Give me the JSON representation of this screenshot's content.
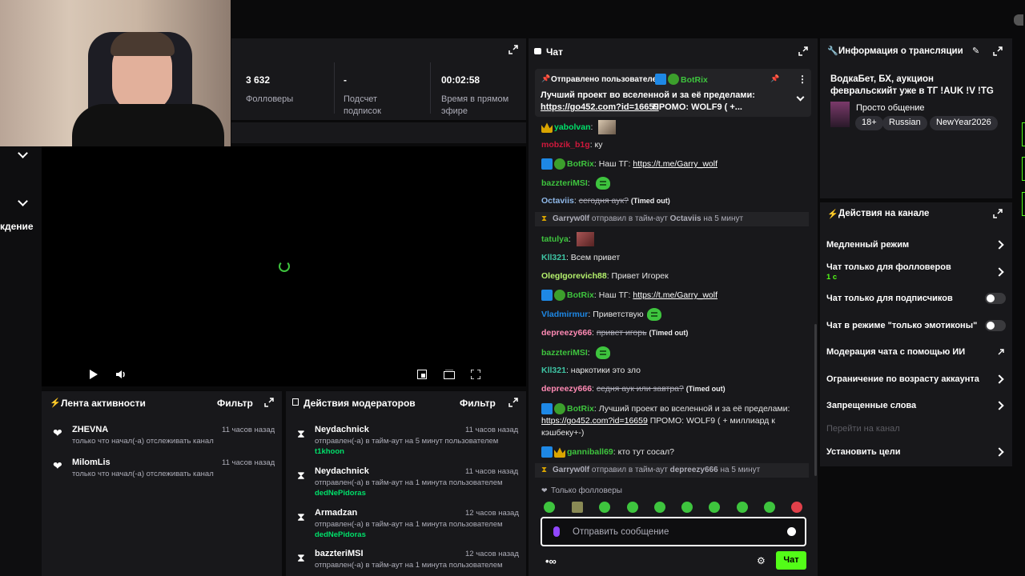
{
  "stats": {
    "followers_value": "3 632",
    "followers_label": "Фолловеры",
    "subs_value": "-",
    "subs_label": "Подсчет подписок",
    "uptime_value": "00:02:58",
    "uptime_label": "Время в прямом эфире"
  },
  "left_partial_label": "кдение",
  "activity": {
    "title": "Лента активности",
    "filter": "Фильтр",
    "items": [
      {
        "name": "ZHEVNA",
        "text": "только что начал(-а) отслеживать канал",
        "time": "11 часов назад"
      },
      {
        "name": "MilomLis",
        "text": "только что начал(-а) отслеживать канал",
        "time": "11 часов назад"
      }
    ]
  },
  "mod": {
    "title": "Действия модераторов",
    "filter": "Фильтр",
    "items": [
      {
        "name": "Neydachnick",
        "text": "отправлен(-а) в тайм-аут на 5 минут пользователем",
        "target": "t1khoon",
        "time": "11 часов назад"
      },
      {
        "name": "Neydachnick",
        "text": "отправлен(-а) в тайм-аут на 1 минута пользователем",
        "target": "dedNePidoras",
        "time": "11 часов назад"
      },
      {
        "name": "Armadzan",
        "text": "отправлен(-а) в тайм-аут на 1 минута пользователем",
        "target": "dedNePidoras",
        "time": "12 часов назад"
      },
      {
        "name": "bazzteriMSI",
        "text": "отправлен(-а) в тайм-аут на 1 минута пользователем",
        "target": "",
        "time": "12 часов назад"
      }
    ]
  },
  "chat": {
    "title": "Чат",
    "pinned_by": "Отправлено пользователем",
    "pinned_user": "BotRix",
    "pinned_text": "Лучший проект во вселенной и за её пределами:",
    "pinned_link": "https://go452.com?id=16659",
    "pinned_tail": "ПРОМО: WOLF9 ( +...",
    "messages": [
      {
        "user": "yabolvan",
        "color": "#00e06a",
        "text": ""
      },
      {
        "user": "mobzik_b1g",
        "color": "#d0183c",
        "text": "ку"
      },
      {
        "user": "BotRix",
        "color": "#3ec43e",
        "text": "Наш ТГ:",
        "link": "https://t.me/Garry_wolf"
      },
      {
        "user": "bazzteriMSI",
        "color": "#3ec43e",
        "text": ""
      },
      {
        "user": "Octaviis",
        "color": "#8fb8e8",
        "text": "сегодня аук?",
        "timeout": "(Timed out)"
      },
      {
        "user": "tatulya",
        "color": "#3ec43e",
        "text": ""
      },
      {
        "user": "Kll321",
        "color": "#3ec4a4",
        "text": "Всем привет"
      },
      {
        "user": "OlegIgorevich88",
        "color": "#b4f06c",
        "text": "Привет Игорек"
      },
      {
        "user": "BotRix",
        "color": "#3ec43e",
        "text": "Наш ТГ:",
        "link": "https://t.me/Garry_wolf"
      },
      {
        "user": "Vladmirmur",
        "color": "#1e88e5",
        "text": "Приветствую"
      },
      {
        "user": "depreezy666",
        "color": "#ff8ab4",
        "text": "привет игорь",
        "timeout": "(Timed out)"
      },
      {
        "user": "bazzteriMSI",
        "color": "#3ec43e",
        "text": ""
      },
      {
        "user": "Kll321",
        "color": "#3ec4a4",
        "text": "наркотики это зло"
      },
      {
        "user": "depreezy666",
        "color": "#ff8ab4",
        "text": "седня аук или завтра?",
        "timeout": "(Timed out)"
      },
      {
        "user": "BotRix",
        "color": "#3ec43e",
        "text": "Лучший проект во вселенной и за её пределами:",
        "link": "https://go452.com?id=16659",
        "tail": "ПРОМО: WOLF9 ( + миллиард к кэшбеку+-)"
      },
      {
        "user": "ganniball69",
        "color": "#3ec43e",
        "text": "кто тут сосал?"
      }
    ],
    "sys1": {
      "mod": "Garryw0lf",
      "mid": "отправил в тайм-аут",
      "target": "Octaviis",
      "dur": "на 5 минут"
    },
    "sys2": {
      "mod": "Garryw0lf",
      "mid": "отправил в тайм-аут",
      "target": "depreezy666",
      "dur": "на 5 минут"
    },
    "followers_only": "Только фолловеры",
    "input_placeholder": "Отправить сообщение",
    "send_label": "Чат"
  },
  "info": {
    "title": "Информация о трансляции",
    "stream_title": "ВодкаБет, БХ, аукцион февральскийт уже в ТГ !AUK !V !TG",
    "category": "Просто общение",
    "tags": [
      "18+",
      "Russian",
      "NewYear2026"
    ]
  },
  "actions": {
    "title": "Действия на канале",
    "slow": "Медленный режим",
    "followers": "Чат только для фолловеров",
    "followers_sub": "1 с",
    "subs": "Чат только для подписчиков",
    "emote": "Чат в режиме \"только эмотиконы\"",
    "ai": "Модерация чата с помощью ИИ",
    "age": "Ограничение по возрасту аккаунта",
    "words": "Запрещенные слова",
    "goto": "Перейти на канал",
    "goals": "Установить цели"
  }
}
